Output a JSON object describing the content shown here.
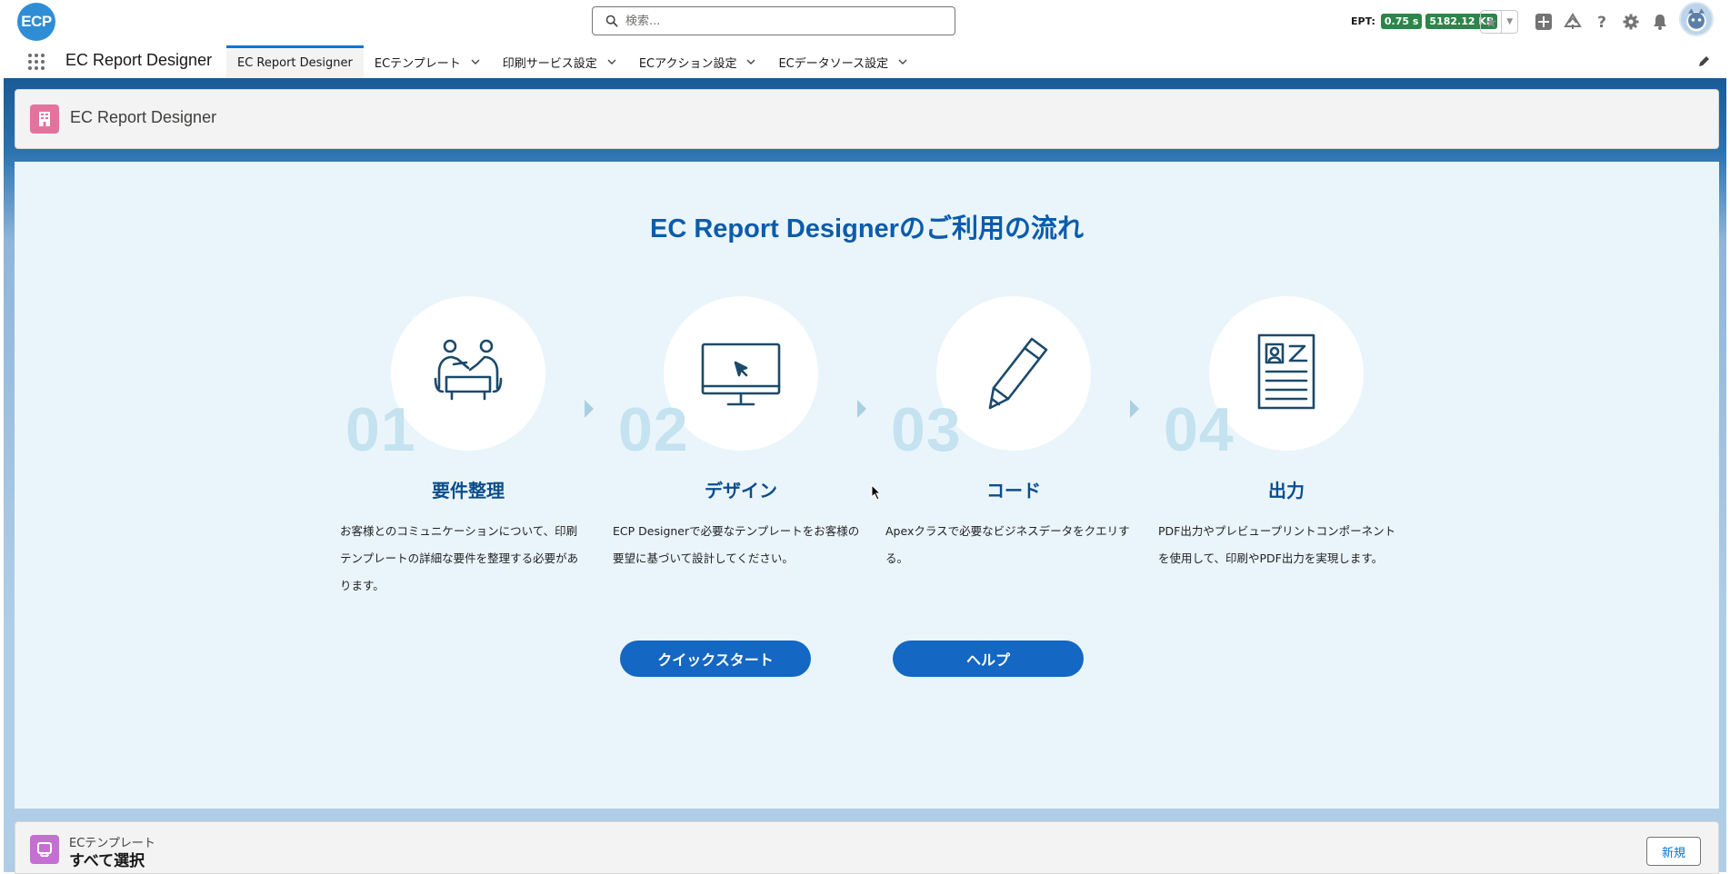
{
  "header": {
    "logo_text": "ECP",
    "search_placeholder": "検索...",
    "ept_label": "EPT:",
    "ept_time": "0.75 s",
    "ept_size": "5182.12 KB",
    "icons": [
      "star-icon",
      "chevron-down-icon",
      "add-icon",
      "trailhead-icon",
      "help-icon",
      "setup-gear-icon",
      "bell-icon",
      "avatar"
    ]
  },
  "nav": {
    "app_name": "EC Report Designer",
    "tabs": [
      {
        "label": "EC Report Designer",
        "active": true
      },
      {
        "label": "ECテンプレート"
      },
      {
        "label": "印刷サービス設定"
      },
      {
        "label": "ECアクション設定"
      },
      {
        "label": "ECデータソース設定"
      }
    ]
  },
  "page_header": {
    "title": "EC Report Designer"
  },
  "hero": {
    "title": "EC Report Designerのご利用の流れ",
    "steps": [
      {
        "num": "01",
        "label": "要件整理",
        "desc": "お客様とのコミュニケーションについて、印刷テンプレートの詳細な要件を整理する必要があります。",
        "icon": "meeting-icon"
      },
      {
        "num": "02",
        "label": "デザイン",
        "desc": "ECP Designerで必要なテンプレートをお客様の要望に基づいて設計してください。",
        "icon": "monitor-icon"
      },
      {
        "num": "03",
        "label": "コード",
        "desc": "Apexクラスで必要なビジネスデータをクエリする。",
        "icon": "pencil-icon"
      },
      {
        "num": "04",
        "label": "出力",
        "desc": "PDF出力やプレビュープリントコンポーネントを使用して、印刷やPDF出力を実現します。",
        "icon": "document-icon"
      }
    ],
    "quickstart_label": "クイックスタート",
    "help_label": "ヘルプ"
  },
  "list_card": {
    "object_label": "ECテンプレート",
    "view_label": "すべて選択",
    "new_label": "新規"
  },
  "colors": {
    "brand": "#0176d3",
    "hero_title": "#0b5cab",
    "button": "#1467c3",
    "step_number": "#c4e2ef",
    "ept_badge": "#2e844a"
  }
}
